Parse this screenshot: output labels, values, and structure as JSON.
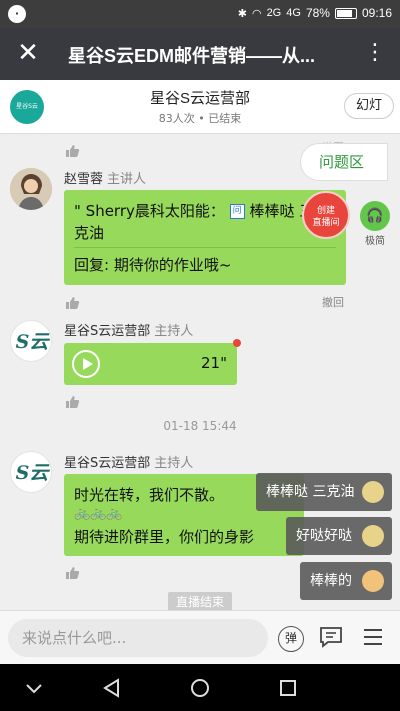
{
  "status_bar": {
    "left_icon": "notification-circle",
    "network": "4G",
    "network2": "2G",
    "battery": "78%",
    "time": "09:16"
  },
  "title_bar": {
    "title": "星谷S云EDM邮件营销——从...",
    "close_icon": "close-icon",
    "more_icon": "more-vertical-icon"
  },
  "room": {
    "logo_text": "星谷S云",
    "title": "星谷S云运营部",
    "subtitle": "83人次 • 已结束",
    "slide_button": "幻灯"
  },
  "messages": {
    "withdraw_top": "撤回",
    "m1": {
      "name": "赵雪蓉",
      "role": "主讲人",
      "quote": "\" Sherry晨科太阳能：",
      "quote_tail": "棒棒哒 三",
      "quote_line2": "克油",
      "reply": "回复: 期待你的作业哦~",
      "withdraw": "撤回"
    },
    "m2": {
      "name": "星谷S云运营部",
      "role": "主持人",
      "duration": "21\""
    },
    "timestamp": "01-18 15:44",
    "m3": {
      "name": "星谷S云运营部",
      "role": "主持人",
      "line1": "时光在转，我们不散。",
      "emoji_line": "🚲🚲🚲",
      "line2": "期待进阶群里，你们的身影"
    }
  },
  "overlay": {
    "question_zone": "问题区",
    "create_live": "创建\n直播间",
    "listen_label": "极简"
  },
  "danmu": [
    {
      "text": "棒棒哒 三克油"
    },
    {
      "text": "好哒好哒"
    },
    {
      "text": "棒棒的"
    }
  ],
  "live_end": "直播结束",
  "input_bar": {
    "placeholder": "来说点什么吧...",
    "danmu_button": "弹"
  },
  "avatar_initials": {
    "s": "S云"
  }
}
